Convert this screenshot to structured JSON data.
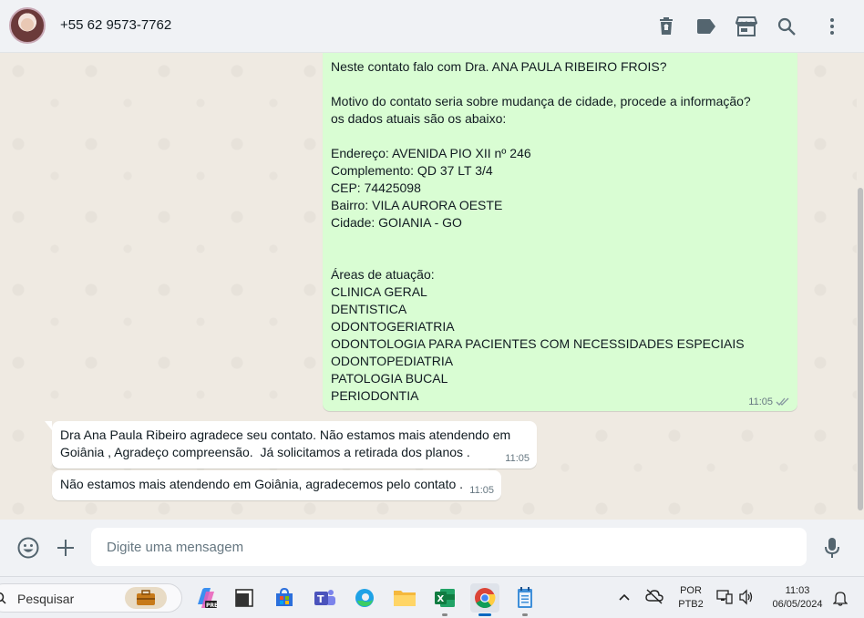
{
  "header": {
    "contact_name": "+55 62 9573-7762",
    "icons": [
      "trash-icon",
      "label-icon",
      "store-icon",
      "search-icon",
      "more-vertical-icon"
    ]
  },
  "messages": {
    "outgoing": {
      "lines": [
        "Neste contato falo com Dra. ANA PAULA RIBEIRO FROIS?",
        "",
        "Motivo do contato seria sobre mudança de cidade, procede a informação?",
        "os dados atuais são os abaixo:",
        "",
        "Endereço: AVENIDA PIO XII nº 246",
        "Complemento: QD 37 LT 3/4",
        "CEP: 74425098",
        "Bairro: VILA AURORA OESTE",
        "Cidade: GOIANIA - GO",
        "",
        "",
        "Áreas de atuação:",
        "CLINICA GERAL",
        "DENTISTICA",
        "ODONTOGERIATRIA",
        "ODONTOLOGIA PARA PACIENTES COM NECESSIDADES ESPECIAIS",
        "ODONTOPEDIATRIA",
        "PATOLOGIA BUCAL",
        "PERIODONTIA"
      ],
      "time": "11:05"
    },
    "incoming": [
      {
        "lines": [
          "Dra Ana Paula Ribeiro agradece seu contato. Não estamos mais atendendo em",
          "Goiânia , Agradeço compreensão.  Já solicitamos a retirada dos planos ."
        ],
        "time": "11:05"
      },
      {
        "lines": [
          "Não estamos mais atendendo em Goiânia, agradecemos pelo contato ."
        ],
        "time": "11:05"
      }
    ]
  },
  "composer": {
    "placeholder": "Digite uma mensagem",
    "icons": [
      "emoji-icon",
      "plus-icon",
      "microphone-icon"
    ]
  },
  "taskbar": {
    "search_label": "Pesquisar",
    "apps": [
      "briefcase-icon",
      "copilot-icon",
      "window-icon",
      "store-icon",
      "teams-icon",
      "edge-icon",
      "folder-icon",
      "excel-icon",
      "chrome-icon",
      "notepad-icon"
    ],
    "language_line1": "POR",
    "language_line2": "PTB2",
    "time": "11:03",
    "date": "06/05/2024"
  },
  "colors": {
    "outgoing_bubble": "#d9fdd3",
    "incoming_bubble": "#ffffff",
    "header_bg": "#f0f2f5",
    "chat_bg": "#efeae2",
    "tick_read": "#8696a0"
  }
}
